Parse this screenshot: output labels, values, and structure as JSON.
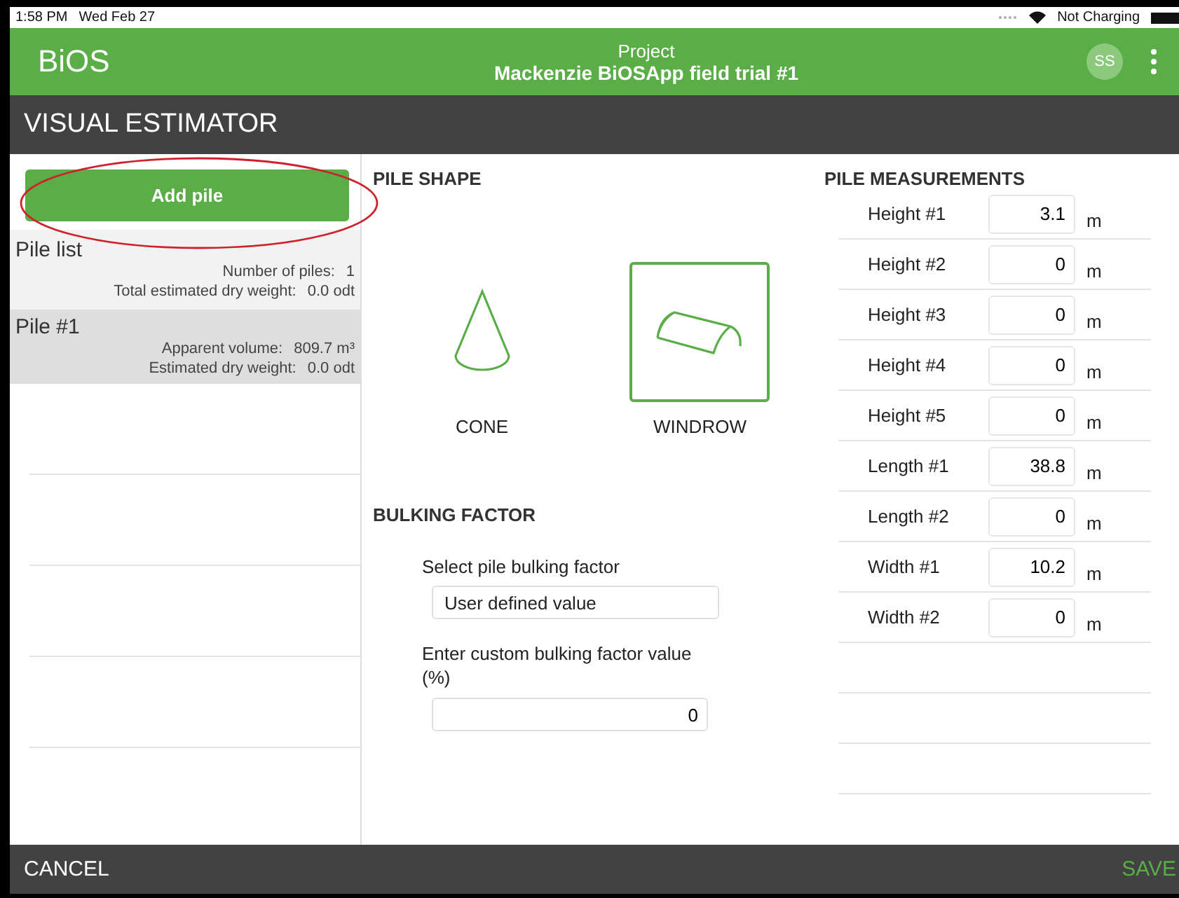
{
  "status_bar": {
    "time": "1:58 PM",
    "date": "Wed Feb 27",
    "battery": "Not Charging"
  },
  "app_bar": {
    "logo": "BiOS",
    "subtitle": "Project",
    "title": "Mackenzie BiOSApp field trial #1",
    "avatar": "SS"
  },
  "screen_title": "VISUAL ESTIMATOR",
  "add_button": "Add pile",
  "pile_list": {
    "title": "Pile list",
    "stats": [
      {
        "label": "Number of piles:",
        "value": "1"
      },
      {
        "label": "Total estimated dry weight:",
        "value": "0.0  odt"
      }
    ]
  },
  "piles": [
    {
      "name": "Pile #1",
      "selected": true,
      "stats": [
        {
          "label": "Apparent volume:",
          "value": "809.7 m³"
        },
        {
          "label": "Estimated dry weight:",
          "value": "0.0  odt"
        }
      ]
    }
  ],
  "pile_shape": {
    "heading": "PILE SHAPE",
    "options": [
      {
        "kind": "cone",
        "label": "CONE",
        "selected": false
      },
      {
        "kind": "windrow",
        "label": "WINDROW",
        "selected": true
      }
    ]
  },
  "bulking": {
    "heading": "BULKING FACTOR",
    "select_label": "Select pile bulking factor",
    "select_value": "User defined value",
    "custom_label": "Enter custom bulking factor value (%)",
    "custom_value": "0"
  },
  "measurements": {
    "heading": "PILE MEASUREMENTS",
    "rows": [
      {
        "label": "Height #1",
        "value": "3.1",
        "unit": "m"
      },
      {
        "label": "Height #2",
        "value": "0",
        "unit": "m"
      },
      {
        "label": "Height #3",
        "value": "0",
        "unit": "m"
      },
      {
        "label": "Height #4",
        "value": "0",
        "unit": "m"
      },
      {
        "label": "Height #5",
        "value": "0",
        "unit": "m"
      },
      {
        "label": "Length #1",
        "value": "38.8",
        "unit": "m"
      },
      {
        "label": "Length #2",
        "value": "0",
        "unit": "m"
      },
      {
        "label": "Width #1",
        "value": "10.2",
        "unit": "m"
      },
      {
        "label": "Width #2",
        "value": "0",
        "unit": "m"
      }
    ]
  },
  "footer": {
    "cancel": "CANCEL",
    "save": "SAVE"
  }
}
